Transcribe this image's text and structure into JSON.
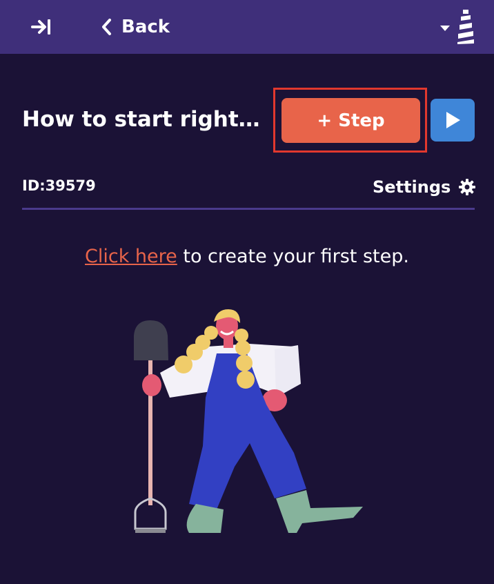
{
  "header": {
    "back_label": "Back",
    "icons": {
      "collapse": "collapse-panel-icon",
      "back": "chevron-left-icon",
      "menu": "caret-down-icon",
      "logo": "lighthouse-logo-icon"
    }
  },
  "guide": {
    "title": "How to start right a...",
    "id_text": "ID:39579",
    "add_step_label": "+ Step",
    "settings_label": "Settings"
  },
  "empty_state": {
    "link_text": "Click here",
    "message": " to create your first step."
  },
  "colors": {
    "background": "#1b1236",
    "topbar": "#3f2f7a",
    "accent_orange": "#e8644a",
    "play_blue": "#3f86d8",
    "highlight_red": "#e2382e",
    "divider": "#4a3a8c"
  }
}
